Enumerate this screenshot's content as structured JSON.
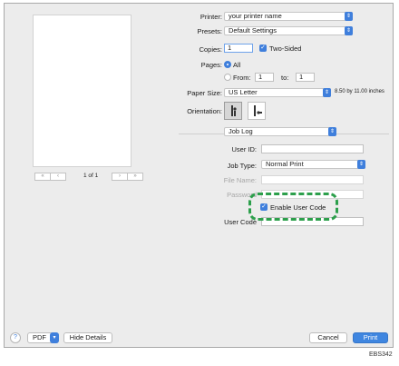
{
  "dialog": {
    "printer": {
      "label": "Printer:",
      "value": "your printer name"
    },
    "presets": {
      "label": "Presets:",
      "value": "Default Settings"
    },
    "copies": {
      "label": "Copies:",
      "value": "1",
      "two_sided_label": "Two-Sided",
      "two_sided_checked": true
    },
    "pages": {
      "label": "Pages:",
      "all_label": "All",
      "from_label": "From:",
      "from_value": "1",
      "to_label": "to:",
      "to_value": "1",
      "selected": "All"
    },
    "paper_size": {
      "label": "Paper Size:",
      "value": "US Letter",
      "dimensions": "8.50 by 11.00 inches"
    },
    "orientation": {
      "label": "Orientation:",
      "selected": "portrait"
    },
    "section_popup": "Job Log",
    "user_id": {
      "label": "User ID:",
      "value": ""
    },
    "job_type": {
      "label": "Job Type:",
      "value": "Normal Print"
    },
    "file_name": {
      "label": "File Name:",
      "value": ""
    },
    "password": {
      "label": "Password",
      "value": ""
    },
    "enable_user_code": {
      "label": "Enable User Code",
      "checked": true
    },
    "user_code": {
      "label": "User Code",
      "value": ""
    }
  },
  "preview": {
    "page_indicator": "1 of 1"
  },
  "footer": {
    "help_symbol": "?",
    "pdf_label": "PDF",
    "hide_details_label": "Hide Details",
    "cancel_label": "Cancel",
    "print_label": "Print"
  },
  "figure_code": "EBS342",
  "colors": {
    "accent": "#3f7fdc",
    "highlight": "#2c9f4b"
  }
}
